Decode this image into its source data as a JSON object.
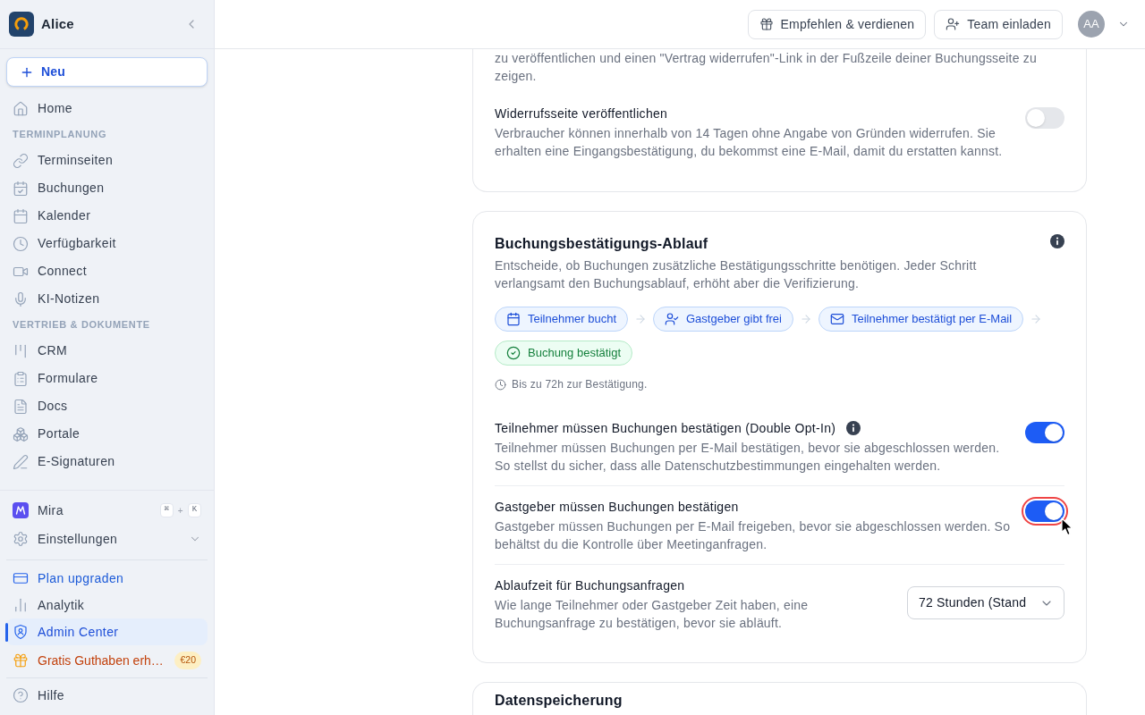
{
  "sidebar": {
    "workspace": "Alice",
    "new_button": "Neu",
    "items": [
      {
        "label": "Home",
        "selected": false
      }
    ],
    "sections": [
      {
        "title": "TERMINPLANUNG",
        "items": [
          {
            "label": "Terminseiten",
            "selected": false
          },
          {
            "label": "Buchungen",
            "selected": false
          },
          {
            "label": "Kalender",
            "selected": false
          },
          {
            "label": "Verfügbarkeit",
            "selected": false
          },
          {
            "label": "Connect",
            "selected": false
          },
          {
            "label": "KI-Notizen",
            "selected": false
          }
        ]
      },
      {
        "title": "VERTRIEB & DOKUMENTE",
        "items": [
          {
            "label": "CRM",
            "selected": false
          },
          {
            "label": "Formulare",
            "selected": false
          },
          {
            "label": "Docs",
            "selected": false
          },
          {
            "label": "Portale",
            "selected": false
          },
          {
            "label": "E-Signaturen",
            "selected": false
          }
        ]
      }
    ],
    "assistant": {
      "label": "Mira",
      "shortcut": {
        "keys": [
          "⌘",
          "K"
        ],
        "joiner": "+"
      }
    },
    "settings": {
      "label": "Einstellungen",
      "expanded": false
    },
    "footer_items": [
      {
        "kind": "upgrade",
        "label": "Plan upgraden",
        "selected": false
      },
      {
        "kind": "item",
        "label": "Analytik",
        "selected": false
      },
      {
        "kind": "item",
        "label": "Admin Center",
        "selected": true
      },
      {
        "kind": "promo",
        "label": "Gratis Guthaben erh…",
        "badge": "€20",
        "selected": false
      }
    ],
    "help": {
      "label": "Hilfe"
    }
  },
  "topbar": {
    "buttons": [
      "Empfehlen & verdienen",
      "Team einladen"
    ],
    "avatar": "AA"
  },
  "cards": [
    {
      "intro": "zu veröffentlichen und einen \"Vertrag widerrufen\"-Link in der Fußzeile deiner Buchungsseite zu zeigen.",
      "settings": [
        {
          "kind": "toggle",
          "title": "Widerrufsseite veröffentlichen",
          "description": "Verbraucher können innerhalb von 14 Tagen ohne Angabe von Gründen widerrufen. Sie erhalten eine Eingangsbestätigung, du bekommst eine E-Mail, damit du erstatten kannst.",
          "on": false,
          "focused": false
        }
      ]
    },
    {
      "title": "Buchungsbestätigungs-Ablauf",
      "info": true,
      "description": "Entscheide, ob Buchungen zusätzliche Bestätigungsschritte benötigen. Jeder Schritt verlangsamt den Buchungsablauf, erhöht aber die Verifizierung.",
      "flow": {
        "steps": [
          {
            "kind": "step",
            "label": "Teilnehmer bucht"
          },
          {
            "kind": "step",
            "label": "Gastgeber gibt frei"
          },
          {
            "kind": "step",
            "label": "Teilnehmer bestätigt per E-Mail"
          },
          {
            "kind": "result",
            "label": "Buchung bestätigt"
          }
        ],
        "note": "Bis zu 72h zur Bestätigung."
      },
      "settings": [
        {
          "kind": "toggle",
          "title": "Teilnehmer müssen Buchungen bestätigen (Double Opt-In)",
          "info": true,
          "description": "Teilnehmer müssen Buchungen per E-Mail bestätigen, bevor sie abgeschlossen werden. So stellst du sicher, dass alle Datenschutzbestimmungen eingehalten werden.",
          "on": true,
          "focused": false
        },
        {
          "kind": "toggle",
          "title": "Gastgeber müssen Buchungen bestätigen",
          "description": "Gastgeber müssen Buchungen per E-Mail freigeben, bevor sie abgeschlossen werden. So behältst du die Kontrolle über Meetinganfragen.",
          "on": true,
          "focused": true
        },
        {
          "kind": "select",
          "title": "Ablaufzeit für Buchungsanfragen",
          "description": "Wie lange Teilnehmer oder Gastgeber Zeit haben, eine Buchungsanfrage zu bestätigen, bevor sie abläuft.",
          "value": "72 Stunden (Stand"
        }
      ]
    },
    {
      "title": "Datenspeicherung"
    }
  ]
}
